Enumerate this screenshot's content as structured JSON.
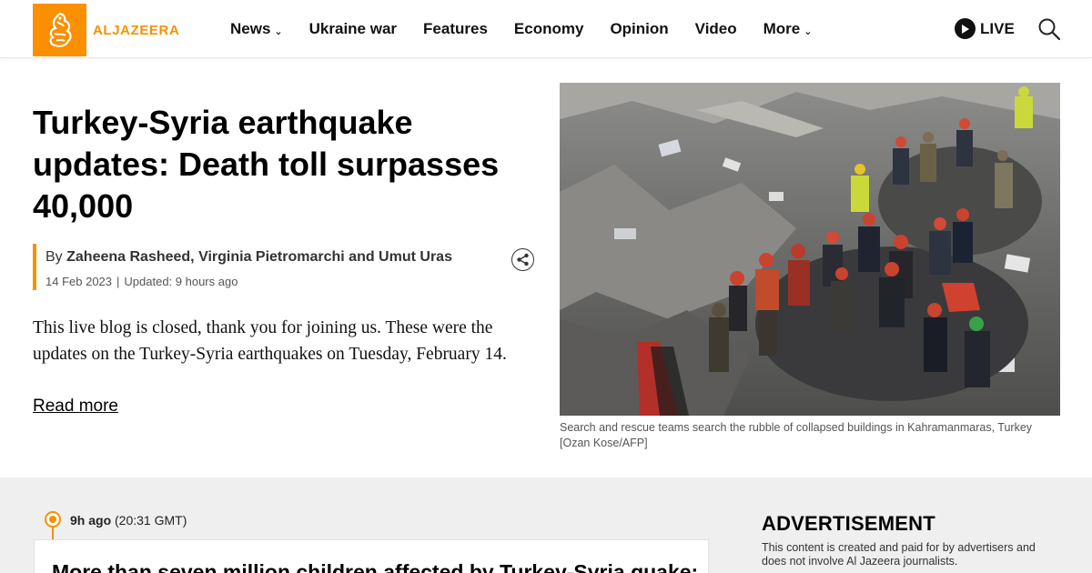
{
  "brand": {
    "name": "ALJAZEERA",
    "accent": "#fa9000"
  },
  "nav": {
    "items": [
      {
        "label": "News",
        "dropdown": true
      },
      {
        "label": "Ukraine war",
        "dropdown": false
      },
      {
        "label": "Features",
        "dropdown": false
      },
      {
        "label": "Economy",
        "dropdown": false
      },
      {
        "label": "Opinion",
        "dropdown": false
      },
      {
        "label": "Video",
        "dropdown": false
      },
      {
        "label": "More",
        "dropdown": true
      }
    ],
    "live_label": "LIVE",
    "search_icon": "search-icon"
  },
  "article": {
    "headline": "Turkey-Syria earthquake updates: Death toll surpasses 40,000",
    "by_prefix": "By",
    "authors": "Zaheena Rasheed, Virginia Pietromarchi and Umut Uras",
    "published": "14 Feb 2023",
    "updated": "Updated: 9 hours ago",
    "summary": "This live blog is closed, thank you for joining us. These were the updates on the Turkey-Syria earthquakes on Tuesday, February 14.",
    "read_more": "Read more",
    "image_caption": "Search and rescue teams search the rubble of collapsed buildings in Kahramanmaras, Turkey [Ozan Kose/AFP]"
  },
  "live_feed": {
    "relative_time": "9h ago",
    "gmt_time": "(20:31 GMT)",
    "first_post_title": "More than seven million children affected by Turkey-Syria quake:"
  },
  "advertisement": {
    "heading": "ADVERTISEMENT",
    "note": "This content is created and paid for by advertisers and does not involve Al Jazeera journalists."
  }
}
